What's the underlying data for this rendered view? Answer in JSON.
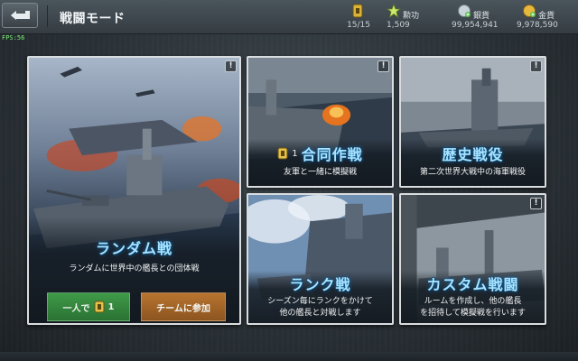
{
  "header": {
    "title": "戦闘モード",
    "fps": "FPS:56"
  },
  "resources": {
    "fuel": {
      "value": "15/15",
      "icon": "fuel-can-icon"
    },
    "merit": {
      "label": "勲功",
      "value": "1,509",
      "icon": "star-icon"
    },
    "silver": {
      "label": "銀貨",
      "value": "99,954,941",
      "icon": "silver-coin-icon"
    },
    "gold": {
      "label": "金貨",
      "value": "9,978,590",
      "icon": "gold-coin-icon"
    }
  },
  "modes": {
    "random": {
      "title": "ランダム戦",
      "desc": "ランダムに世界中の艦長との団体戦",
      "solo_label": "一人で",
      "solo_cost": "1",
      "team_label": "チームに参加"
    },
    "joint": {
      "title": "合同作戦",
      "cost": "1",
      "desc": "友軍と一緒に模擬戦"
    },
    "history": {
      "title": "歴史戦役",
      "desc": "第二次世界大戦中の海軍戦役"
    },
    "ranked": {
      "title": "ランク戦",
      "desc_line1": "シーズン毎にランクをかけて",
      "desc_line2": "他の艦長と対戦します"
    },
    "custom": {
      "title": "カスタム戦闘",
      "desc_line1": "ルームを作成し、他の艦長",
      "desc_line2": "を招待して模擬戦を行います"
    },
    "info_symbol": "!"
  },
  "colors": {
    "title_glow": "#a8e4ff",
    "green_button": "#3f9a48",
    "orange_button": "#b8752f",
    "fps_text": "#7ef07a"
  }
}
